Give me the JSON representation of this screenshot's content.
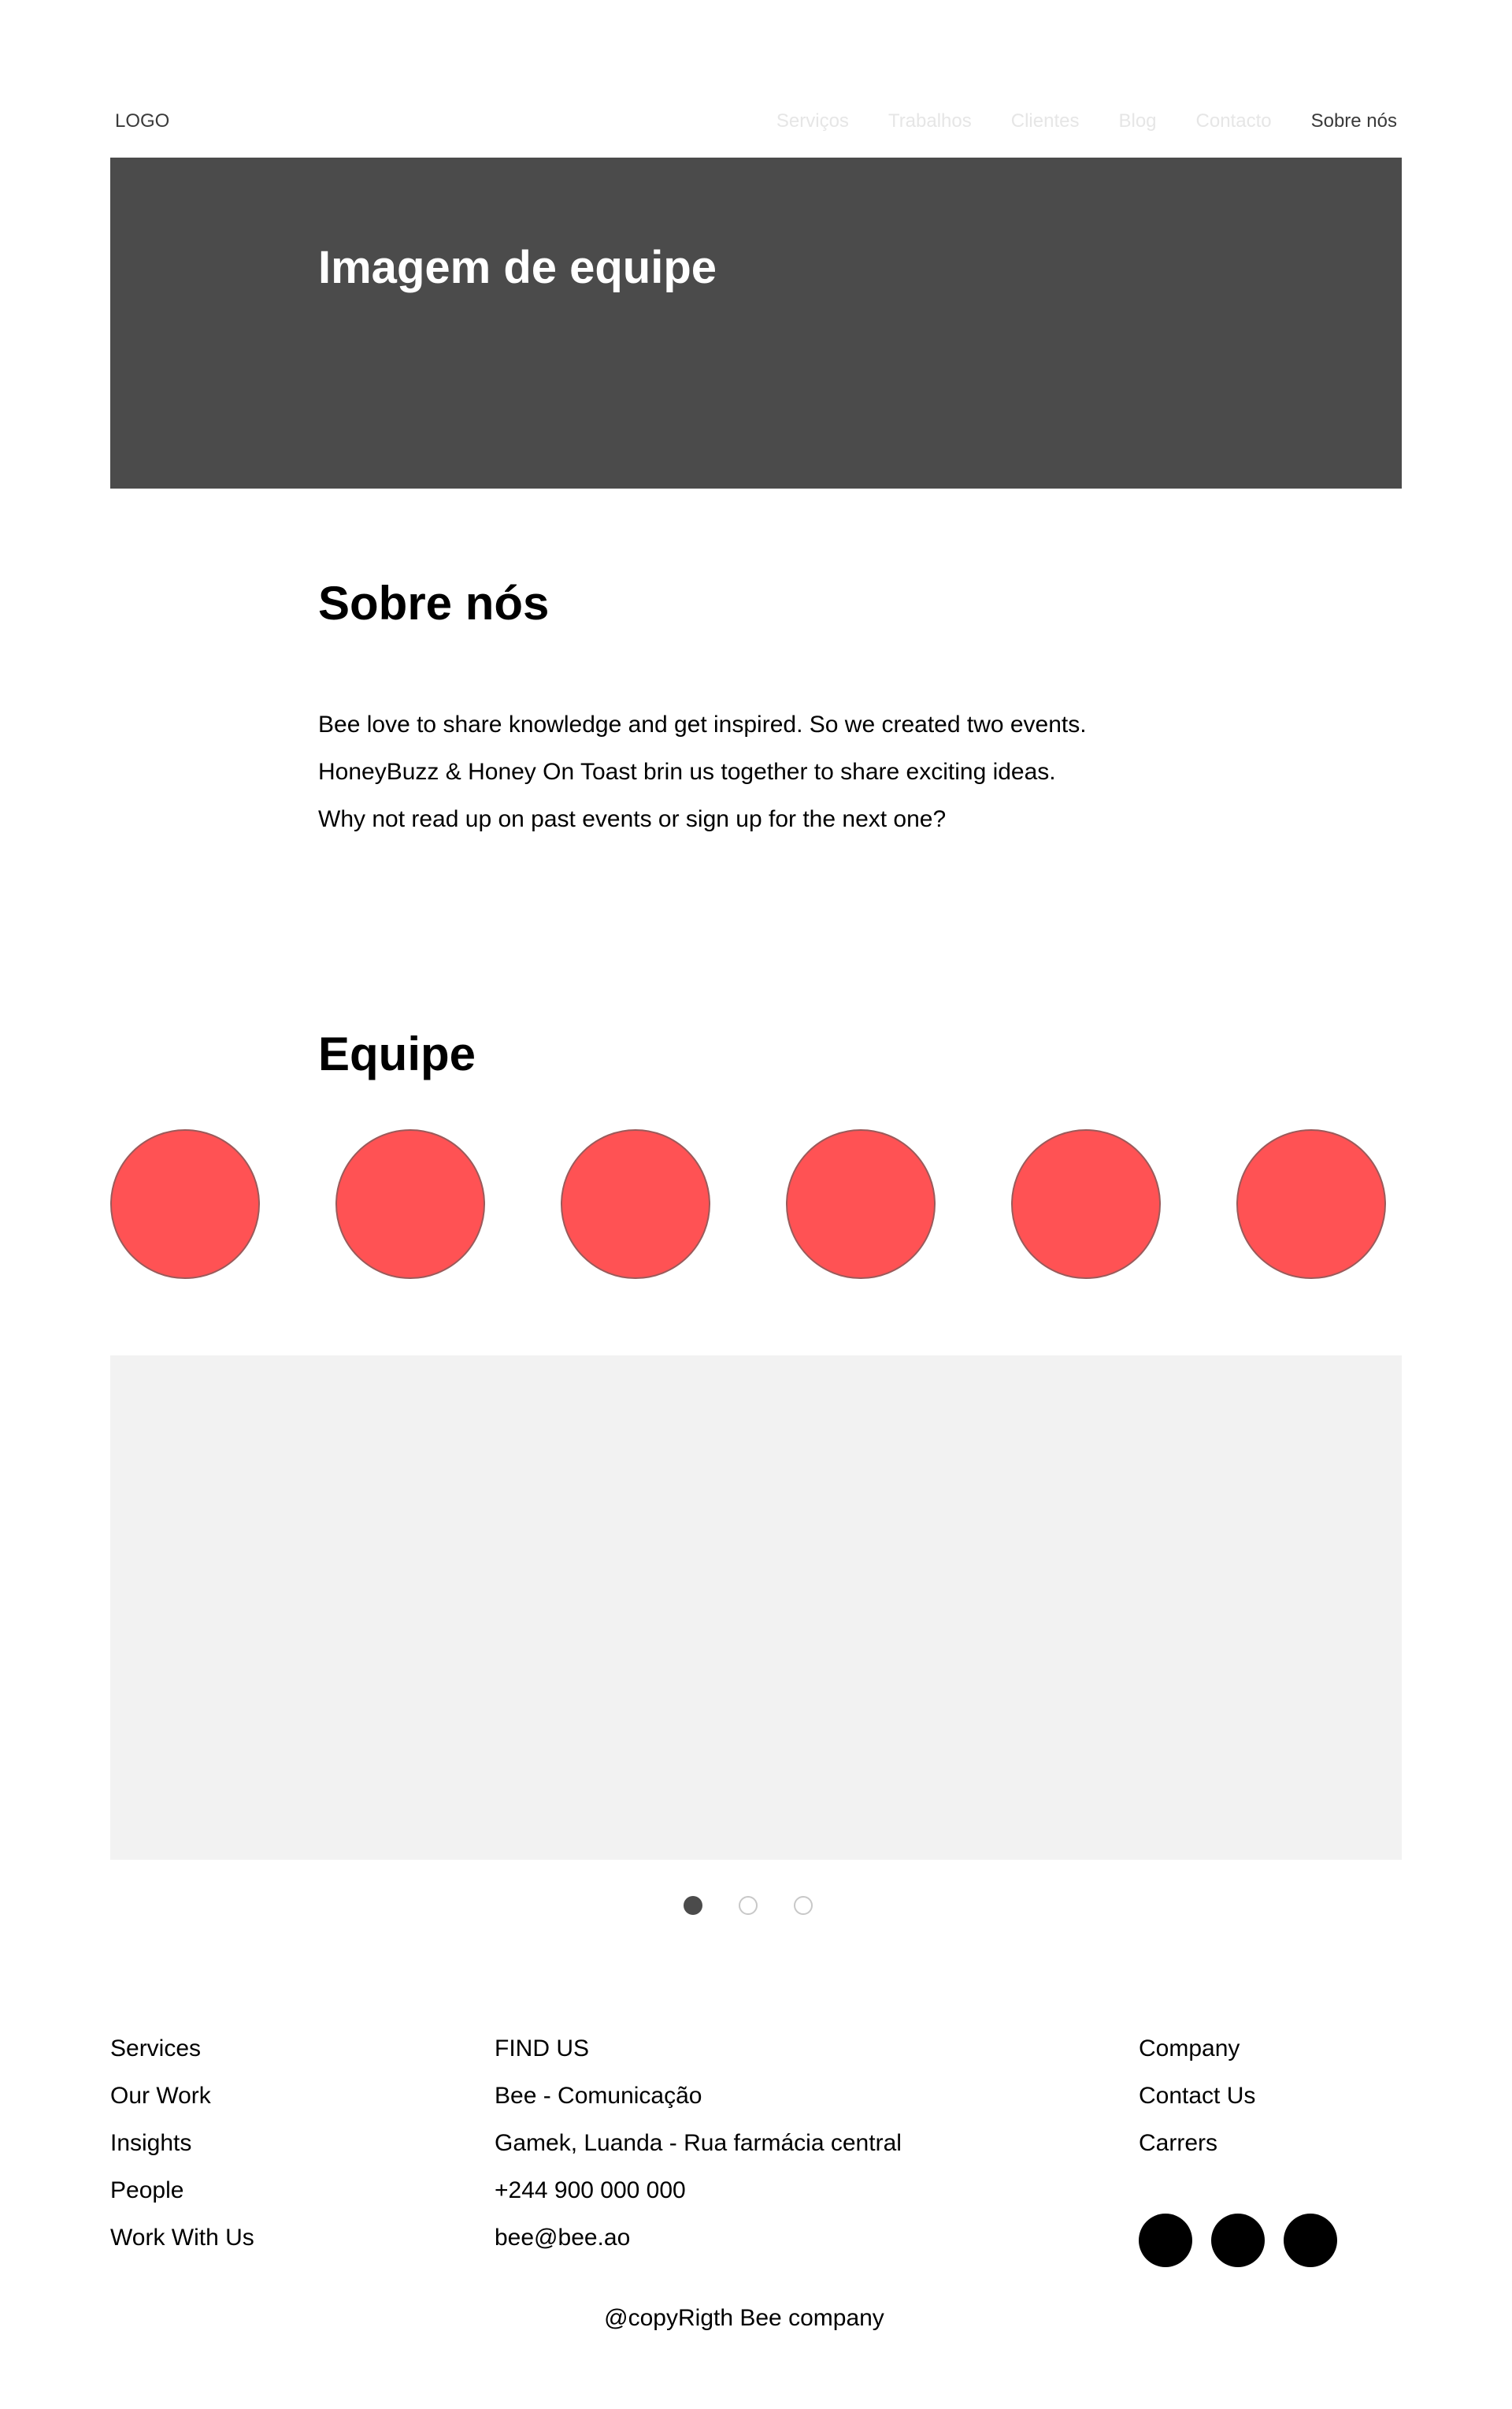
{
  "header": {
    "logo": "LOGO",
    "nav": [
      {
        "label": "Serviços"
      },
      {
        "label": "Trabalhos"
      },
      {
        "label": "Clientes"
      },
      {
        "label": "Blog"
      },
      {
        "label": "Contacto"
      },
      {
        "label": "Sobre nós",
        "active": true
      }
    ]
  },
  "hero": {
    "title": "Imagem de equipe"
  },
  "about": {
    "title": "Sobre nós",
    "lines": [
      "Bee love to share knowledge and get inspired. So we created two events.",
      "HoneyBuzz & Honey On Toast brin us together to share exciting ideas.",
      "Why not read up on past events or sign up for the next one?"
    ]
  },
  "team": {
    "title": "Equipe",
    "member_count": 6,
    "avatar_color": "#ff5254"
  },
  "carousel": {
    "slide_count": 3,
    "active_index": 0
  },
  "footer": {
    "col1": [
      "Services",
      "Our Work",
      "Insights",
      "People",
      "Work With Us"
    ],
    "col2": [
      "FIND US",
      "Bee - Comunicação",
      "Gamek, Luanda - Rua farmácia central",
      "+244 900 000 000",
      "bee@bee.ao"
    ],
    "col3": [
      "Company",
      "Contact Us",
      "Carrers"
    ],
    "copyright": "@copyRigth Bee company"
  }
}
